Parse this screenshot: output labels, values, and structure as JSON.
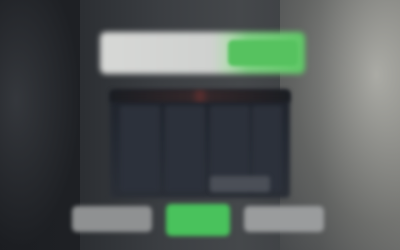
{
  "header": {
    "title": "",
    "action_label": ""
  },
  "panel": {
    "columns": [
      "",
      "",
      "",
      ""
    ]
  },
  "footer": {
    "left_label": "",
    "primary_label": "",
    "right_label": ""
  },
  "colors": {
    "accent": "#56c25f",
    "panel_bg": "#252a33",
    "header_bg": "#d7d8d6"
  }
}
